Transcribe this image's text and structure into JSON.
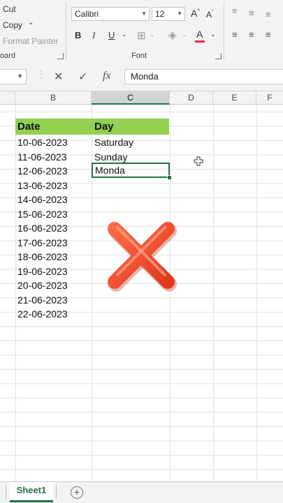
{
  "ribbon": {
    "clipboard": {
      "cut": "Cut",
      "copy": "Copy",
      "copy_dropdown": "⌄",
      "format_painter": "Format Painter",
      "group_label": "oard"
    },
    "font": {
      "font_name": "Calibri",
      "font_size": "12",
      "grow": "A",
      "shrink": "A",
      "bold": "B",
      "italic": "I",
      "underline": "U",
      "font_color_letter": "A",
      "group_label": "Font",
      "font_color": "#e03030"
    }
  },
  "formula_bar": {
    "cancel": "✕",
    "enter": "✓",
    "fx": "fx",
    "value": "Monda"
  },
  "columns": [
    "B",
    "C",
    "D",
    "E",
    "F"
  ],
  "table": {
    "header": {
      "date": "Date",
      "day": "Day"
    },
    "header_color": "#92d050",
    "rows": [
      {
        "date": "10-06-2023",
        "day": "Saturday"
      },
      {
        "date": "11-06-2023",
        "day": "Sunday"
      },
      {
        "date": "12-06-2023",
        "day": ""
      },
      {
        "date": "13-06-2023",
        "day": ""
      },
      {
        "date": "14-06-2023",
        "day": ""
      },
      {
        "date": "15-06-2023",
        "day": ""
      },
      {
        "date": "16-06-2023",
        "day": ""
      },
      {
        "date": "17-06-2023",
        "day": ""
      },
      {
        "date": "18-06-2023",
        "day": ""
      },
      {
        "date": "19-06-2023",
        "day": ""
      },
      {
        "date": "20-06-2023",
        "day": ""
      },
      {
        "date": "21-06-2023",
        "day": ""
      },
      {
        "date": "22-06-2023",
        "day": ""
      }
    ],
    "active_cell_value": "Monda"
  },
  "overlay": {
    "icon": "red-cross-mark",
    "color": "#f04a2a"
  },
  "sheets": {
    "active": "Sheet1",
    "add": "+"
  },
  "accent_color": "#217346"
}
